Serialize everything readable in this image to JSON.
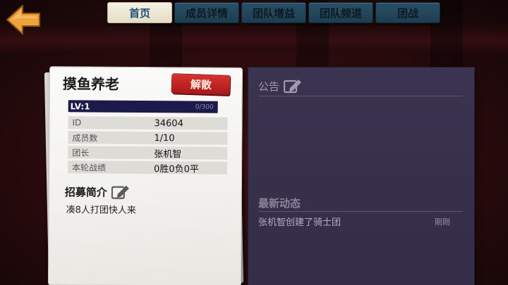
{
  "tabs": [
    {
      "label": "首页",
      "active": true
    },
    {
      "label": "成员详情",
      "active": false
    },
    {
      "label": "团队增益",
      "active": false
    },
    {
      "label": "团队频道",
      "active": false
    },
    {
      "label": "团战",
      "active": false
    }
  ],
  "team": {
    "name": "摸鱼养老",
    "disband_label": "解散",
    "level_label": "LV:1",
    "exp_text": "0/300",
    "exp_progress": 0,
    "info": [
      {
        "key": "ID",
        "value": "34604"
      },
      {
        "key": "成员数",
        "value": "1/10"
      },
      {
        "key": "团长",
        "value": "张机智"
      },
      {
        "key": "本轮战绩",
        "value": "0胜0负0平"
      }
    ],
    "recruit_title": "招募简介",
    "recruit_text": "凑8人打团快人来"
  },
  "notice": {
    "title": "公告"
  },
  "news": {
    "title": "最新动态",
    "items": [
      {
        "text": "张机智创建了骑士团",
        "time": "刚刚"
      }
    ]
  },
  "colors": {
    "accent_orange": "#f0a23a",
    "tab_active_text": "#1f4f7a",
    "disband_red": "#c4221f",
    "panel_bg": "#38324d"
  },
  "icons": {
    "back": "back-arrow-icon",
    "edit": "edit-pencil-icon"
  }
}
